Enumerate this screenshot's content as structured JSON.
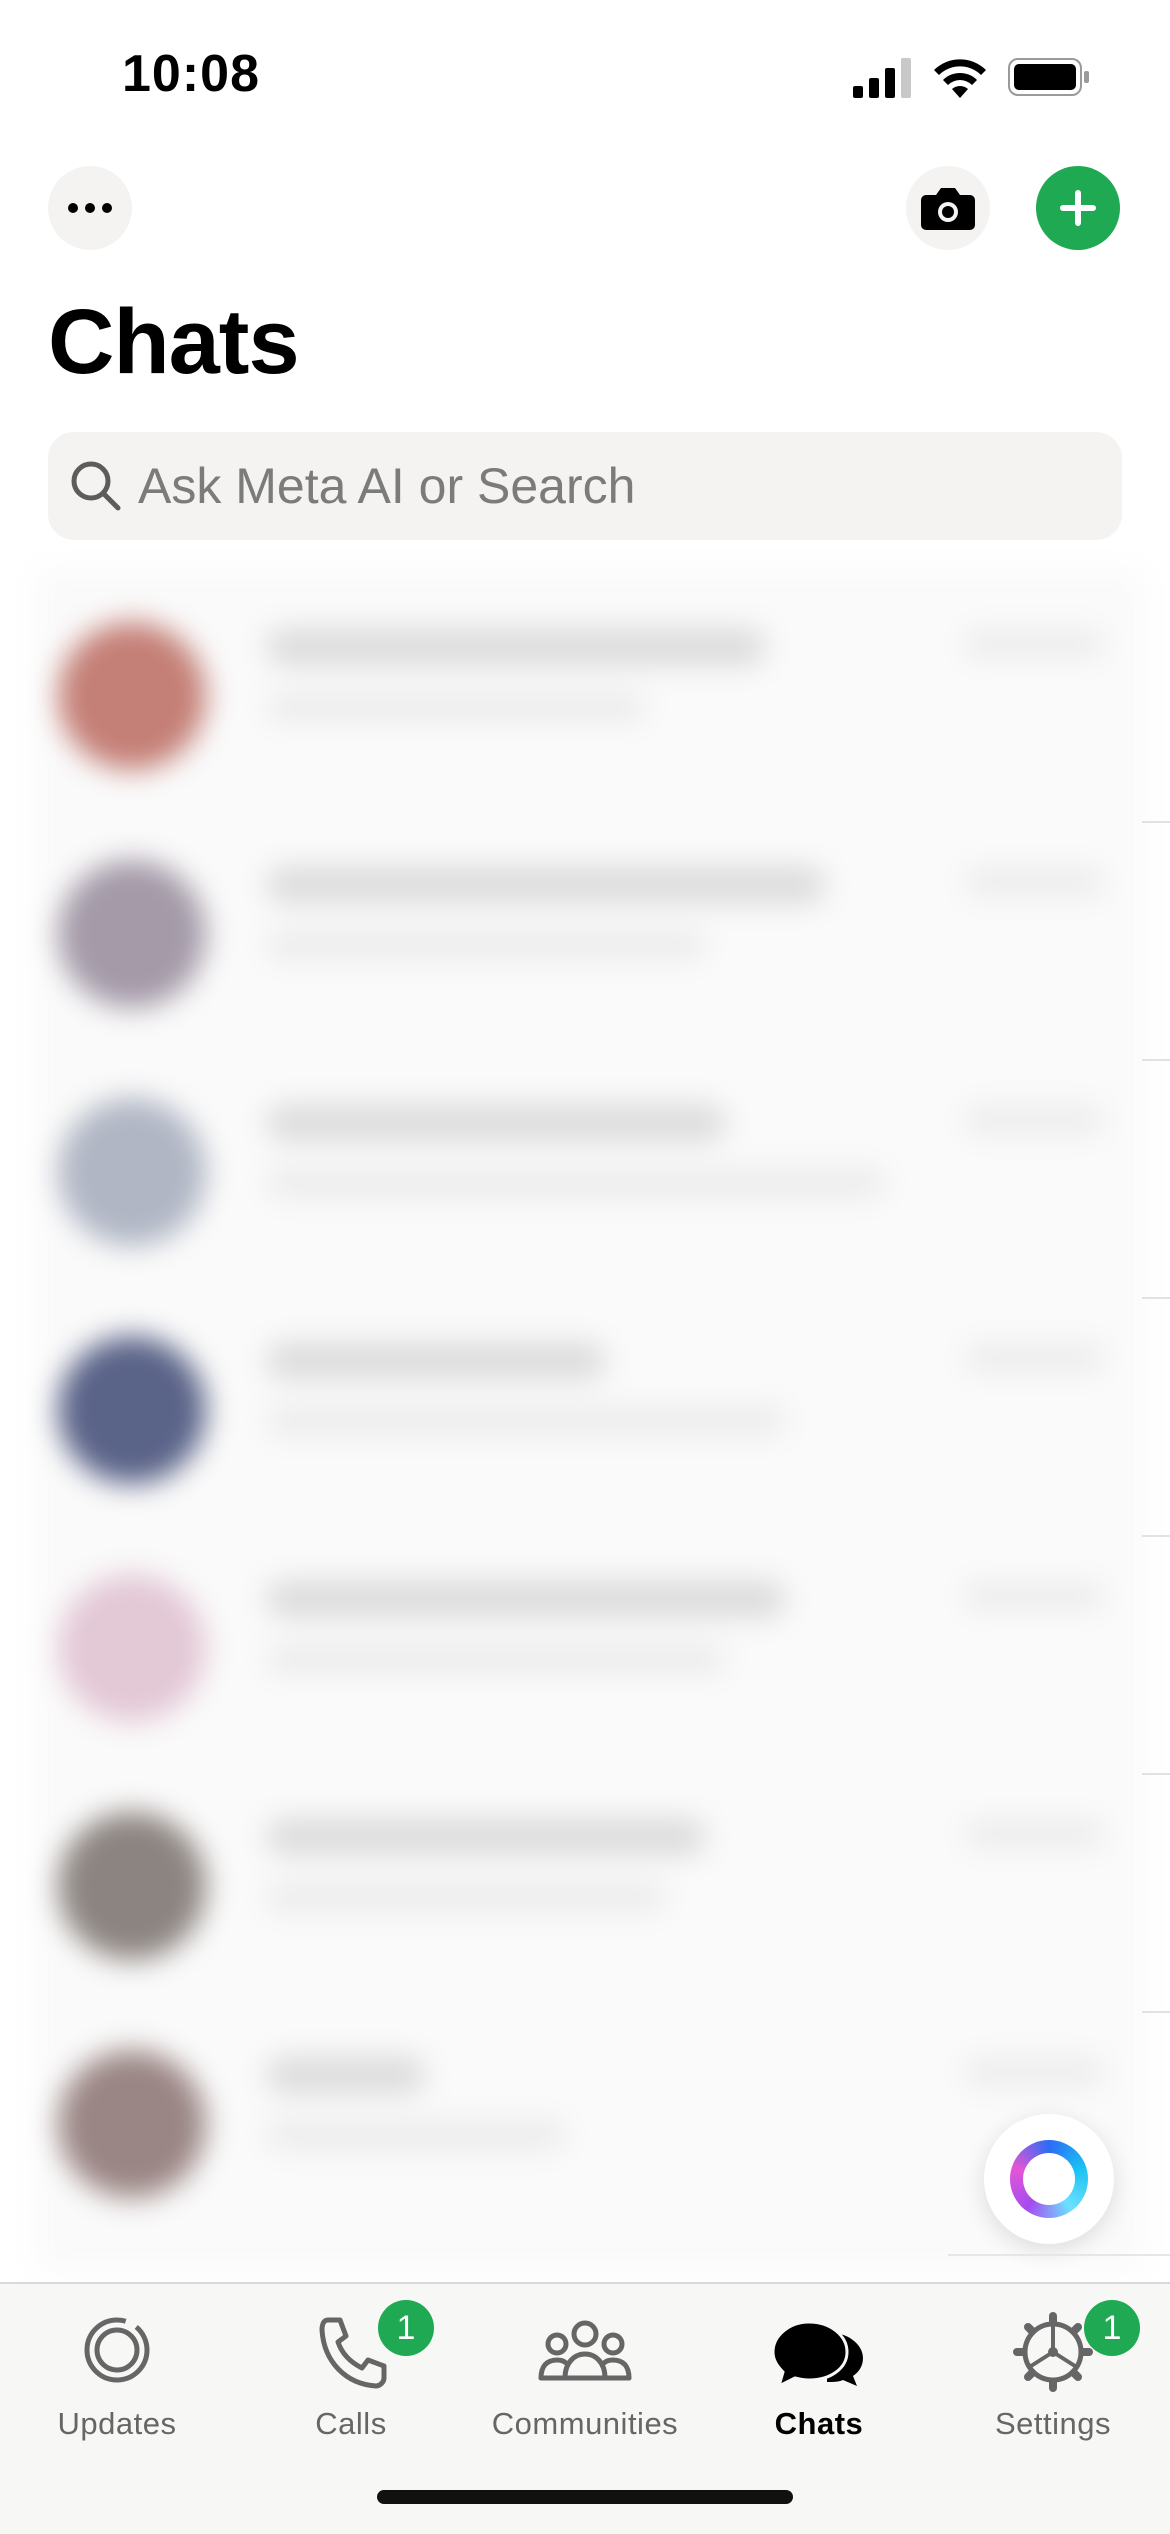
{
  "status_bar": {
    "time": "10:08",
    "signal_icon": "signal-bars-icon",
    "wifi_icon": "wifi-icon",
    "battery_icon": "battery-icon"
  },
  "header": {
    "more_icon": "ellipsis-icon",
    "camera_icon": "camera-icon",
    "add_icon": "plus-icon",
    "title": "Chats"
  },
  "search": {
    "placeholder": "Ask Meta AI or Search",
    "icon": "search-icon"
  },
  "colors": {
    "accent": "#1ea952",
    "search_bg": "#f4f3f1",
    "tab_bg": "#f7f7f6"
  },
  "meta_ai": {
    "icon": "meta-ai-ring-icon"
  },
  "tabs": [
    {
      "label": "Updates",
      "icon": "updates-icon",
      "active": false,
      "badge": ""
    },
    {
      "label": "Calls",
      "icon": "phone-icon",
      "active": false,
      "badge": "1"
    },
    {
      "label": "Communities",
      "icon": "communities-icon",
      "active": false,
      "badge": ""
    },
    {
      "label": "Chats",
      "icon": "chats-icon",
      "active": true,
      "badge": ""
    },
    {
      "label": "Settings",
      "icon": "gear-icon",
      "active": false,
      "badge": "1"
    }
  ]
}
